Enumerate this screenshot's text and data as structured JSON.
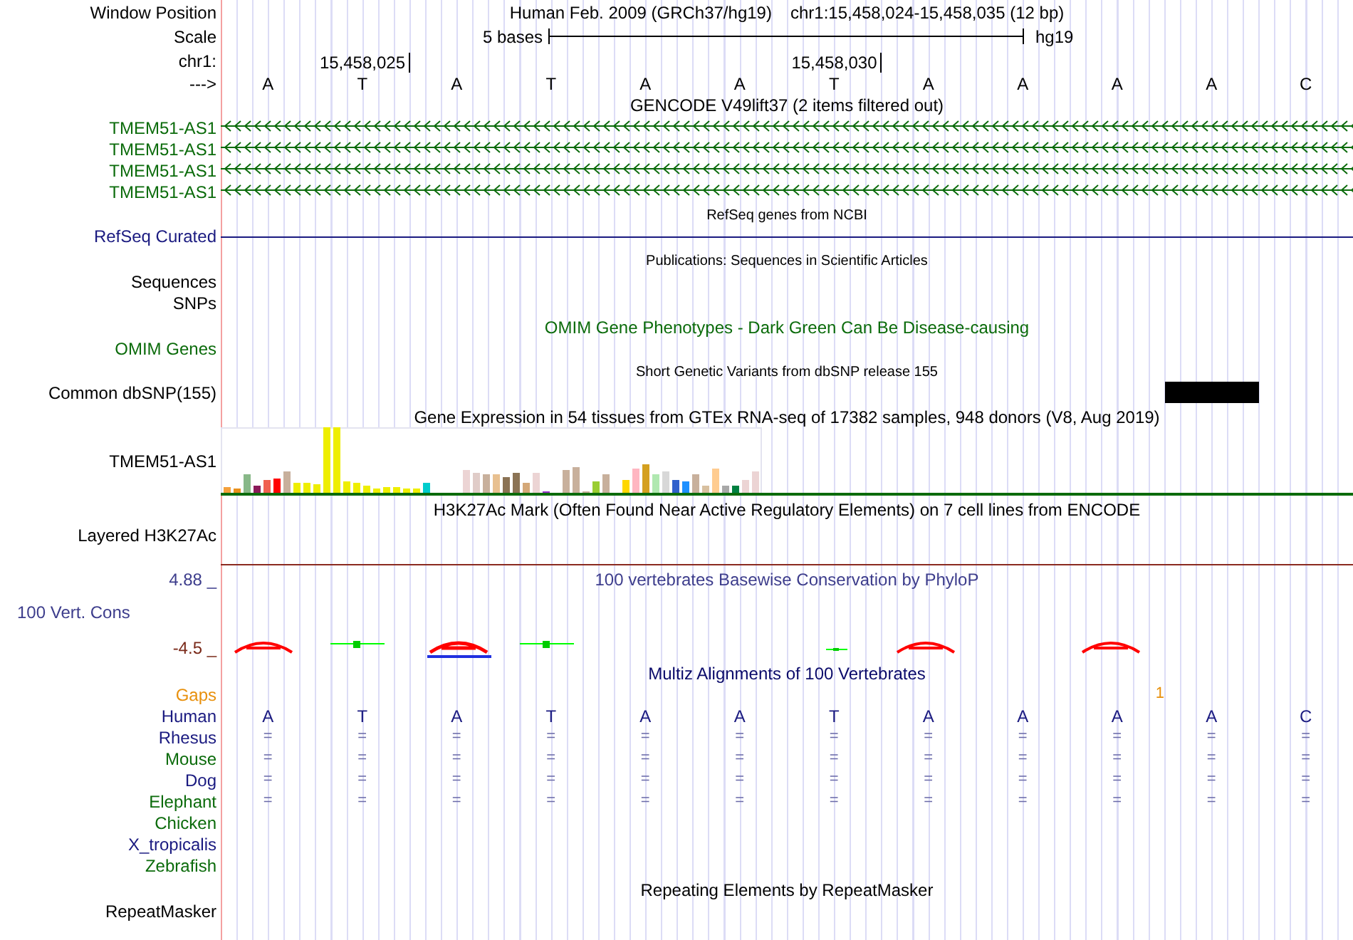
{
  "ruler": {
    "position_label": "Window Position",
    "assembly": "Human Feb. 2009 (GRCh37/hg19)",
    "position": "chr1:15,458,024-15,458,035 (12 bp)",
    "scale_label": "Scale",
    "scale_text": "5 bases",
    "scale_db": "hg19",
    "chrom_label": "chr1:",
    "ticks": [
      "15,458,025",
      "15,458,030"
    ],
    "strand_label": "--->",
    "bases": [
      "A",
      "T",
      "A",
      "T",
      "A",
      "A",
      "T",
      "A",
      "A",
      "A",
      "A",
      "C"
    ]
  },
  "gencode": {
    "title": "GENCODE V49lift37 (2 items filtered out)",
    "genes": [
      {
        "name": "TMEM51-AS1"
      },
      {
        "name": "TMEM51-AS1"
      },
      {
        "name": "TMEM51-AS1"
      },
      {
        "name": "TMEM51-AS1"
      }
    ]
  },
  "refseq": {
    "title": "RefSeq genes from NCBI",
    "label": "RefSeq Curated"
  },
  "publications": {
    "title": "Publications: Sequences in Scientific Articles",
    "labels": [
      "Sequences",
      "SNPs"
    ]
  },
  "omim": {
    "title": "OMIM Gene Phenotypes - Dark Green Can Be Disease-causing",
    "label": "OMIM Genes"
  },
  "dbsnp": {
    "title": "Short Genetic Variants from dbSNP release 155",
    "label": "Common dbSNP(155)"
  },
  "gtex": {
    "title": "Gene Expression in 54 tissues from GTEx RNA-seq of 17382 samples, 948 donors (V8, Aug 2019)",
    "label": "TMEM51-AS1"
  },
  "h3k27ac": {
    "title": "H3K27Ac Mark (Often Found Near Active Regulatory Elements) on 7 cell lines from ENCODE",
    "label": "Layered H3K27Ac"
  },
  "conservation": {
    "title": "100 vertebrates Basewise Conservation by PhyloP",
    "label": "100 Vert. Cons",
    "max": "4.88 _",
    "min": "-4.5 _"
  },
  "multiz": {
    "title": "Multiz Alignments of 100 Vertebrates",
    "gaps_label": "Gaps",
    "gap_mark": "1",
    "human_label": "Human",
    "human_bases": [
      "A",
      "T",
      "A",
      "T",
      "A",
      "A",
      "T",
      "A",
      "A",
      "A",
      "A",
      "C"
    ],
    "species": [
      {
        "name": "Rhesus",
        "color": "#1a1a80",
        "cells": [
          "=",
          "=",
          "=",
          "=",
          "=",
          "=",
          "=",
          "=",
          "=",
          "=",
          "=",
          "="
        ]
      },
      {
        "name": "Mouse",
        "color": "#0b6b0b",
        "cells": [
          "=",
          "=",
          "=",
          "=",
          "=",
          "=",
          "=",
          "=",
          "=",
          "=",
          "=",
          "="
        ]
      },
      {
        "name": "Dog",
        "color": "#1a1a80",
        "cells": [
          "=",
          "=",
          "=",
          "=",
          "=",
          "=",
          "=",
          "=",
          "=",
          "=",
          "=",
          "="
        ]
      },
      {
        "name": "Elephant",
        "color": "#0b6b0b",
        "cells": [
          "=",
          "=",
          "=",
          "=",
          "=",
          "=",
          "=",
          "=",
          "=",
          "=",
          "=",
          "="
        ]
      },
      {
        "name": "Chicken",
        "color": "#0b6b0b"
      },
      {
        "name": "X_tropicalis",
        "color": "#1a1a80"
      },
      {
        "name": "Zebrafish",
        "color": "#0b6b0b"
      }
    ]
  },
  "repeatmasker": {
    "title": "Repeating Elements by RepeatMasker",
    "label": "RepeatMasker"
  }
}
